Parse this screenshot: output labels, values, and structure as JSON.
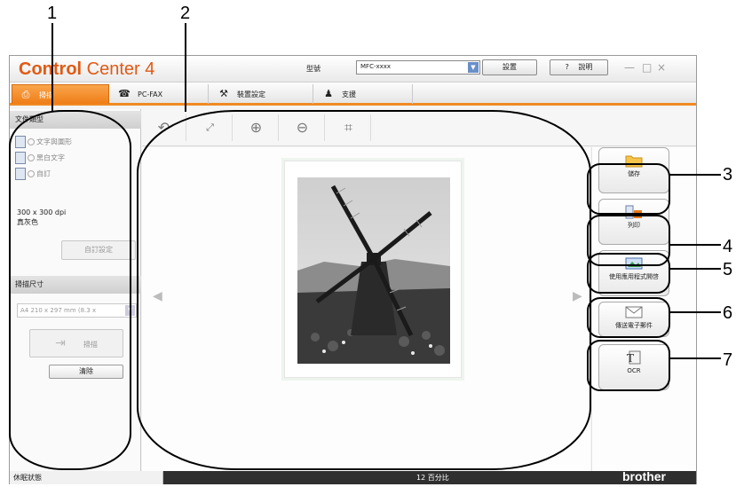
{
  "callouts": [
    "1",
    "2",
    "3",
    "4",
    "5",
    "6",
    "7"
  ],
  "app": {
    "logo_bold": "Control",
    "logo_thin": "Center 4",
    "model_label": "型號",
    "model_value": "MFC-xxxx",
    "settings_label": "設置",
    "help_q": "?",
    "help_label": "說明",
    "window_controls": [
      "—",
      "□",
      "×"
    ]
  },
  "tabs": [
    {
      "label": "掃描",
      "icon": "scan-icon",
      "active": true
    },
    {
      "label": "PC-FAX",
      "icon": "fax-icon",
      "active": false
    },
    {
      "label": "裝置設定",
      "icon": "tools-icon",
      "active": false
    },
    {
      "label": "支援",
      "icon": "support-person-icon",
      "active": false
    }
  ],
  "left": {
    "doc_type_header": "文件類型",
    "doc_types": [
      "文字與圖形",
      "黑白文字",
      "自訂"
    ],
    "resolution": "300 x 300 dpi",
    "color_mode": "真灰色",
    "custom_settings": "自訂設定",
    "scan_size_header": "掃描尺寸",
    "scan_size_value": "A4 210 x 297 mm (8.3 x",
    "scan_button": "掃描",
    "clear_button": "清除"
  },
  "toolbar": [
    "rotate-icon",
    "fit-icon",
    "zoom-in-icon",
    "zoom-out-icon",
    "crop-icon"
  ],
  "actions": [
    {
      "label": "儲存",
      "icon": "folder-icon"
    },
    {
      "label": "列印",
      "icon": "print-icon"
    },
    {
      "label": "使用應用程式開啓",
      "icon": "open-app-icon"
    },
    {
      "label": "傳送電子郵件",
      "icon": "email-icon"
    },
    {
      "label": "OCR",
      "icon": "ocr-icon"
    }
  ],
  "status": {
    "state": "休眠狀態",
    "zoom": "12 百分比",
    "brand": "brother"
  },
  "colors": {
    "accent": "#f08a24",
    "logo": "#e05a14",
    "statusbar": "#2f2f2f"
  }
}
